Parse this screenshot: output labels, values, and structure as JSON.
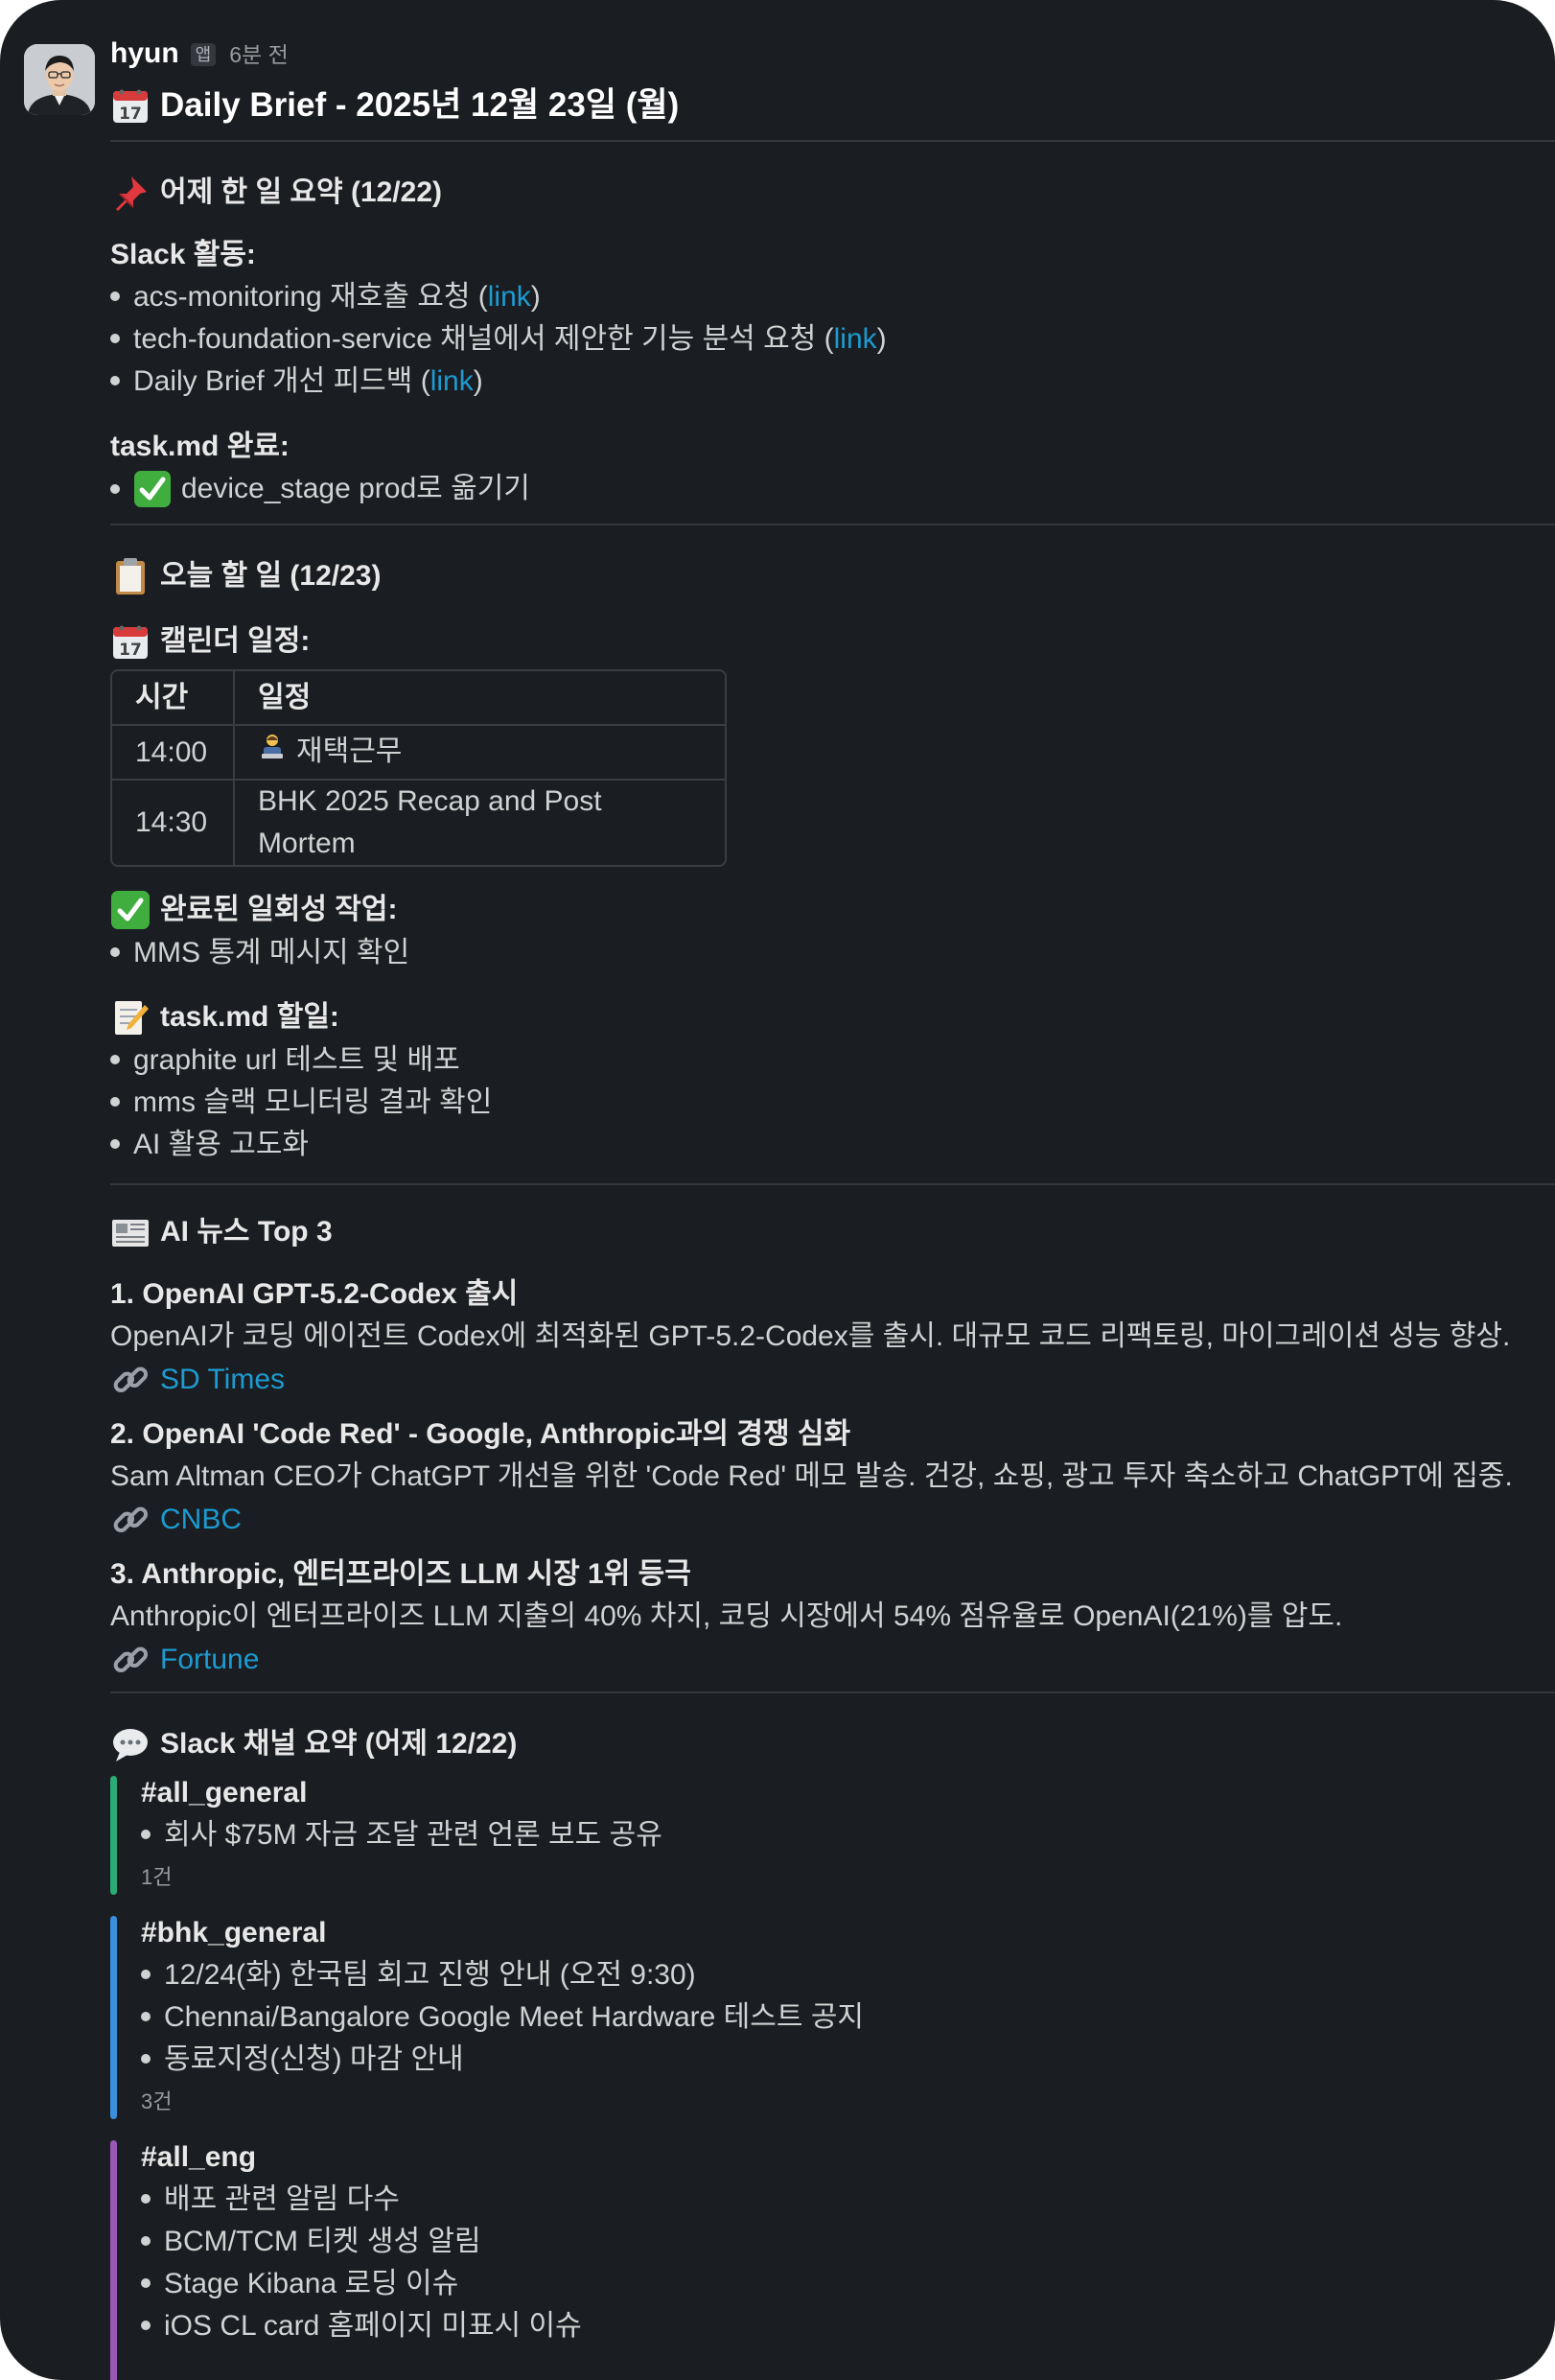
{
  "message": {
    "author": "hyun",
    "app_badge": "앱",
    "timestamp": "6분 전",
    "title": "Daily Brief - 2025년 12월 23일 (월)"
  },
  "yesterday": {
    "title": "어제 한 일 요약 (12/22)",
    "slack_label": "Slack 활동:",
    "slack_items": [
      {
        "text": "acs-monitoring 재호출 요청 (",
        "link": "link",
        "after": ")"
      },
      {
        "text": "tech-foundation-service 채널에서 제안한 기능 분석 요청 (",
        "link": "link",
        "after": ")"
      },
      {
        "text": "Daily Brief 개선 피드백 (",
        "link": "link",
        "after": ")"
      }
    ],
    "task_label": "task.md 완료:",
    "task_items": [
      "device_stage prod로 옮기기"
    ]
  },
  "today": {
    "title": "오늘 할 일 (12/23)",
    "calendar_label": "캘린더 일정:",
    "calendar_headers": [
      "시간",
      "일정"
    ],
    "calendar_rows": [
      {
        "time": "14:00",
        "event": "재택근무"
      },
      {
        "time": "14:30",
        "event": "BHK 2025 Recap and Post Mortem"
      }
    ],
    "done_label": "완료된 일회성 작업:",
    "done_items": [
      "MMS 통계 메시지 확인"
    ],
    "todo_label": "task.md 할일:",
    "todo_items": [
      "graphite url 테스트 및 배포",
      "mms 슬랙 모니터링 결과 확인",
      "AI 활용 고도화"
    ]
  },
  "news": {
    "title": "AI 뉴스 Top 3",
    "items": [
      {
        "headline": "1. OpenAI GPT-5.2-Codex 출시",
        "body": "OpenAI가 코딩 에이전트 Codex에 최적화된 GPT-5.2-Codex를 출시. 대규모 코드 리팩토링, 마이그레이션 성능 향상.",
        "source": "SD Times"
      },
      {
        "headline": "2. OpenAI 'Code Red' - Google, Anthropic과의 경쟁 심화",
        "body": "Sam Altman CEO가 ChatGPT 개선을 위한 'Code Red' 메모 발송. 건강, 쇼핑, 광고 투자 축소하고 ChatGPT에 집중.",
        "source": "CNBC"
      },
      {
        "headline": "3. Anthropic, 엔터프라이즈 LLM 시장 1위 등극",
        "body": "Anthropic이 엔터프라이즈 LLM 지출의 40% 차지, 코딩 시장에서 54% 점유율로 OpenAI(21%)를 압도.",
        "source": "Fortune"
      }
    ]
  },
  "channels": {
    "title": "Slack 채널 요약 (어제 12/22)",
    "items": [
      {
        "name": "#all_general",
        "color": "#2bac76",
        "bullets": [
          "회사 $75M 자금 조달 관련 언론 보도 공유"
        ],
        "count": "1건"
      },
      {
        "name": "#bhk_general",
        "color": "#3a8fde",
        "bullets": [
          "12/24(화) 한국팀 회고 진행 안내 (오전 9:30)",
          "Chennai/Bangalore Google Meet Hardware 테스트 공지",
          "동료지정(신청) 마감 안내"
        ],
        "count": "3건"
      },
      {
        "name": "#all_eng",
        "color": "#9b59b6",
        "bullets": [
          "배포 관련 알림 다수",
          "BCM/TCM 티켓 생성 알림",
          "Stage Kibana 로딩 이슈",
          "iOS CL card 홈페이지 미표시 이슈"
        ],
        "count": ""
      }
    ]
  }
}
